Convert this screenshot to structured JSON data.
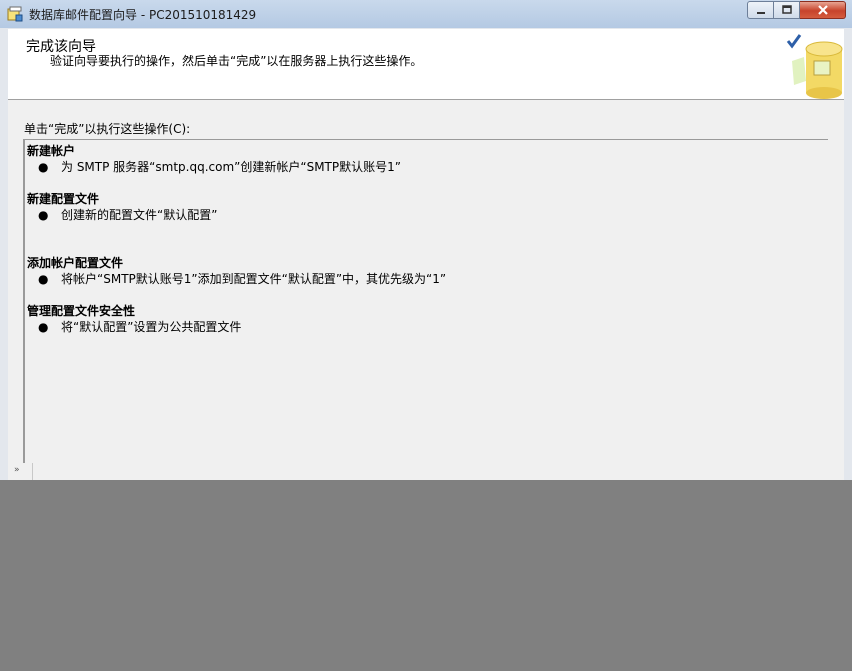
{
  "window": {
    "title": "数据库邮件配置向导 - PC201510181429"
  },
  "header": {
    "title": "完成该向导",
    "subtitle": "验证向导要执行的操作，然后单击“完成”以在服务器上执行这些操作。"
  },
  "body": {
    "prompt": "单击“完成”以执行这些操作(C):"
  },
  "sections": [
    {
      "title": "新建帐户",
      "bullet": "●",
      "item": "为 SMTP 服务器“smtp.qq.com”创建新帐户“SMTP默认账号1”"
    },
    {
      "title": "新建配置文件",
      "bullet": "●",
      "item": "创建新的配置文件“默认配置”"
    },
    {
      "title": "添加帐户配置文件",
      "bullet": "●",
      "item": "将帐户“SMTP默认账号1”添加到配置文件“默认配置”中，其优先级为“1”"
    },
    {
      "title": "管理配置文件安全性",
      "bullet": "●",
      "item": "将“默认配置”设置为公共配置文件"
    }
  ],
  "icons": {
    "app": "database-mail-wizard-icon",
    "minimize": "minimize-icon",
    "maximize": "maximize-icon",
    "close": "close-icon",
    "banner": "database-checkmark-icon"
  },
  "colors": {
    "titlebar": "#b4c9e3",
    "close_button": "#c7432b",
    "background_overlay": "#808080"
  }
}
